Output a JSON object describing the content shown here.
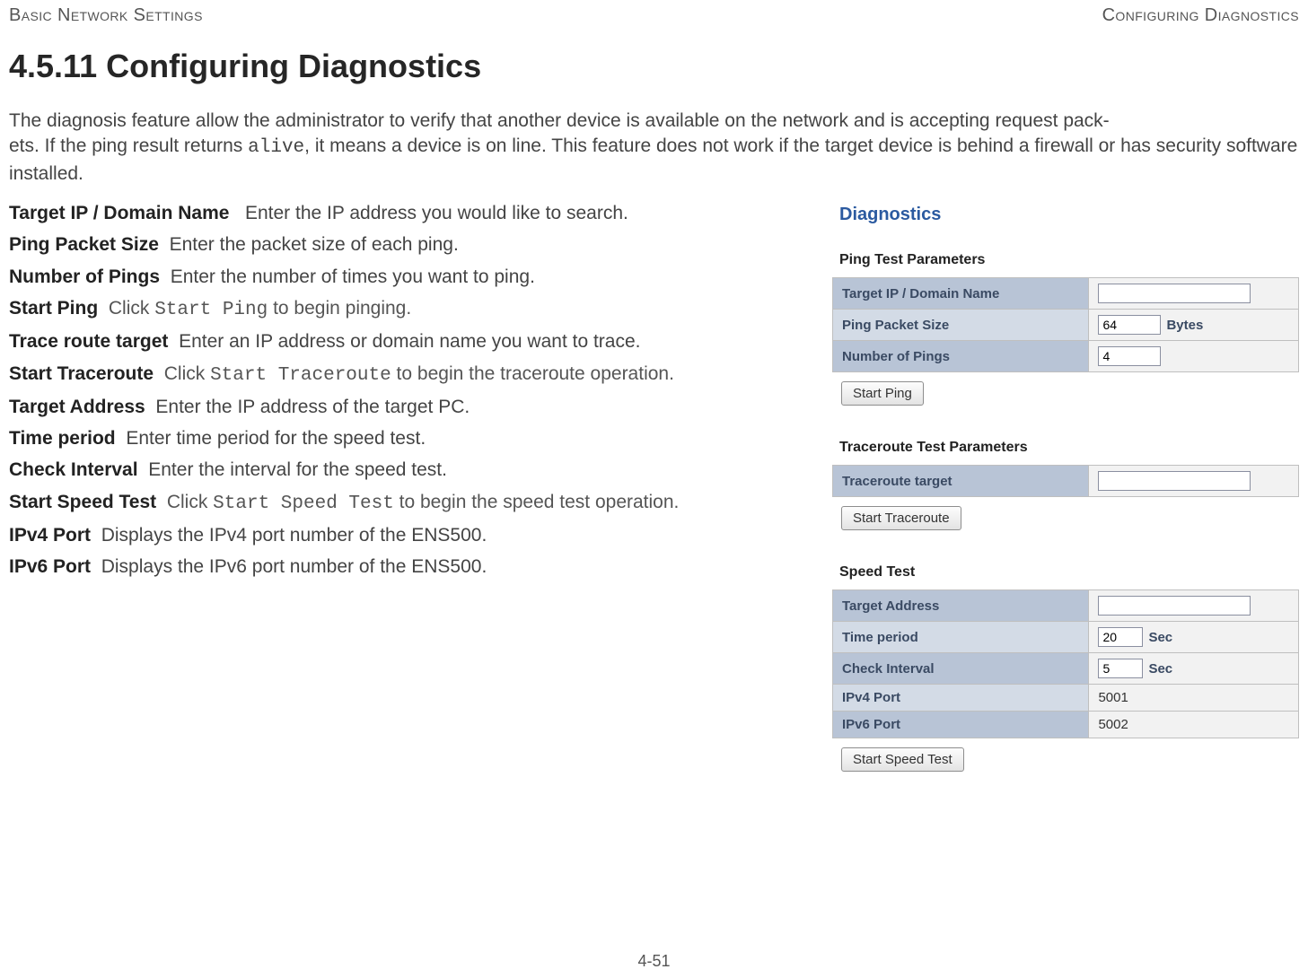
{
  "header": {
    "left": "Basic Network Settings",
    "right": "Configuring Diagnostics"
  },
  "title": "4.5.11 Configuring Diagnostics",
  "intro_parts": {
    "p1": "The diagnosis feature allow the administrator to verify that another device is available on the network and is accepting request pack-",
    "p2": "ets. If the ping result returns ",
    "alive": "alive",
    "p3": ", it means a device is on line. This feature does not work if the target device is behind a firewall or has security software installed."
  },
  "defs": {
    "target_ip": {
      "term": "Target IP / Domain Name",
      "desc": "Enter the IP address you would like to search."
    },
    "ping_size": {
      "term": "Ping Packet Size",
      "desc": "Enter the packet size of each ping."
    },
    "num_pings": {
      "term": "Number of Pings",
      "desc": "Enter the number of times you want to ping."
    },
    "start_ping": {
      "term": "Start Ping",
      "pre": "Click ",
      "mono": "Start Ping",
      "post": " to begin pinging."
    },
    "trace_tgt": {
      "term": "Trace route target",
      "desc": "Enter an IP address or domain name you want to trace."
    },
    "start_trace": {
      "term": "Start Traceroute",
      "pre": "Click ",
      "mono": "Start Traceroute",
      "post": " to begin the traceroute operation."
    },
    "target_addr": {
      "term": "Target Address",
      "desc": "Enter the IP address of the target PC."
    },
    "time_period": {
      "term": "Time period",
      "desc": "Enter time period for the speed test."
    },
    "check_int": {
      "term": "Check Interval",
      "desc": "Enter the interval for the speed test."
    },
    "start_speed": {
      "term": "Start Speed Test",
      "pre": "Click ",
      "mono": "Start Speed Test",
      "post": " to begin the speed test operation."
    },
    "ipv4": {
      "term": "IPv4 Port",
      "desc": "Displays the IPv4 port number of the ENS500."
    },
    "ipv6": {
      "term": "IPv6 Port",
      "desc": "Displays the IPv6 port number of the ENS500."
    }
  },
  "panel": {
    "title": "Diagnostics",
    "ping": {
      "section": "Ping Test Parameters",
      "rows": {
        "target_label": "Target IP / Domain Name",
        "target_value": "",
        "size_label": "Ping Packet Size",
        "size_value": "64",
        "size_unit": "Bytes",
        "count_label": "Number of Pings",
        "count_value": "4"
      },
      "button": "Start Ping"
    },
    "trace": {
      "section": "Traceroute Test Parameters",
      "rows": {
        "target_label": "Traceroute target",
        "target_value": ""
      },
      "button": "Start Traceroute"
    },
    "speed": {
      "section": "Speed Test",
      "rows": {
        "target_label": "Target Address",
        "target_value": "",
        "period_label": "Time period",
        "period_value": "20",
        "period_unit": "Sec",
        "interval_label": "Check Interval",
        "interval_value": "5",
        "interval_unit": "Sec",
        "ipv4_label": "IPv4 Port",
        "ipv4_value": "5001",
        "ipv6_label": "IPv6 Port",
        "ipv6_value": "5002"
      },
      "button": "Start Speed Test"
    }
  },
  "footer": "4-51"
}
